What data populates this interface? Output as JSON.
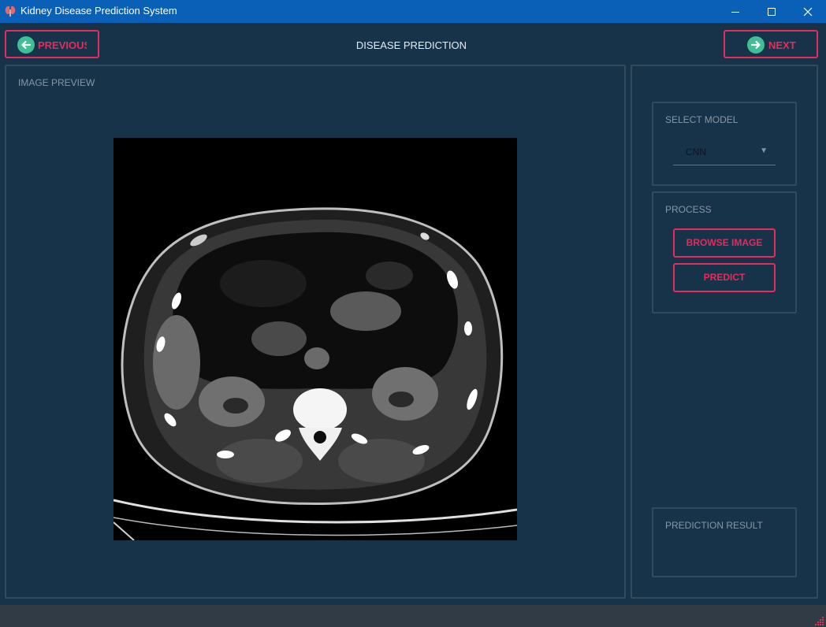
{
  "window": {
    "title": "Kidney Disease Prediction System",
    "icon": "kidney-icon"
  },
  "nav": {
    "previous_label": "PREVIOUS",
    "next_label": "NEXT",
    "page_title": "DISEASE PREDICTION"
  },
  "preview": {
    "label": "IMAGE PREVIEW",
    "image": "abdominal-ct-scan"
  },
  "model": {
    "label": "SELECT MODEL",
    "selected": "CNN"
  },
  "process": {
    "label": "PROCESS",
    "browse_label": "BROWSE IMAGE",
    "predict_label": "PREDICT"
  },
  "result": {
    "label": "PREDICTION RESULT"
  },
  "colors": {
    "background": "#16334a",
    "titlebar": "#0a5fb7",
    "accent": "#e52c5a",
    "icon_circle": "#3fbf95",
    "panel_border": "#33495c",
    "muted_text": "#8797a6",
    "statusbar": "#313b45"
  }
}
